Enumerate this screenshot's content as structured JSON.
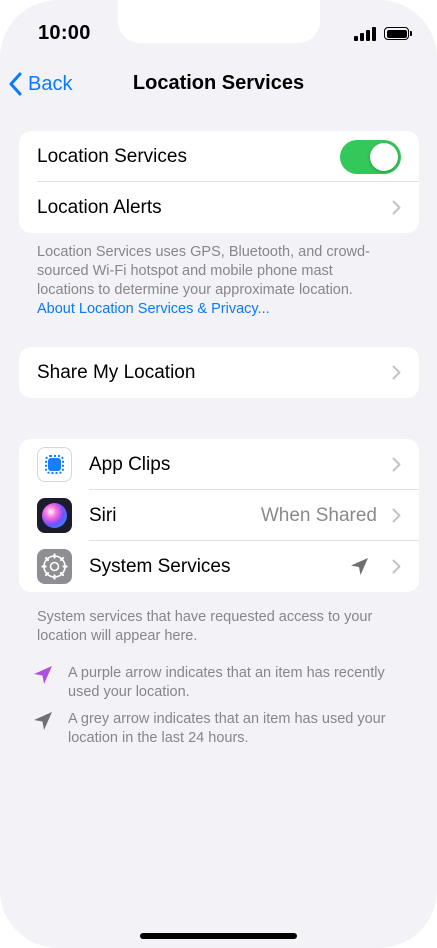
{
  "status_bar": {
    "time": "10:00"
  },
  "nav": {
    "back_label": "Back",
    "title": "Location Services"
  },
  "main_group": {
    "location_services": {
      "label": "Location Services",
      "toggle_on": true
    },
    "location_alerts": {
      "label": "Location Alerts"
    }
  },
  "description": {
    "text": "Location Services uses GPS, Bluetooth, and crowd-sourced Wi-Fi hotspot and mobile phone mast locations to determine your approximate location.",
    "link": "About Location Services & Privacy..."
  },
  "share_group": {
    "share_my_location": {
      "label": "Share My Location"
    }
  },
  "apps_group": {
    "items": [
      {
        "label": "App Clips",
        "icon": "app-clips-icon",
        "value": ""
      },
      {
        "label": "Siri",
        "icon": "siri-icon",
        "value": "When Shared"
      },
      {
        "label": "System Services",
        "icon": "settings-gear-icon",
        "value": "",
        "indicator": "location-arrow-grey"
      }
    ]
  },
  "footer": {
    "system_note": "System services that have requested access to your location will appear here.",
    "purple_arrow_note": "A purple arrow indicates that an item has recently used your location.",
    "grey_arrow_note": "A grey arrow indicates that an item has used your location in the last 24 hours."
  },
  "colors": {
    "accent": "#0a7aff",
    "toggle_on": "#34c759",
    "background": "#f2f2f7",
    "secondary_text": "#86868b",
    "purple_arrow": "#b04fdc",
    "grey_arrow": "#6e6e73"
  }
}
